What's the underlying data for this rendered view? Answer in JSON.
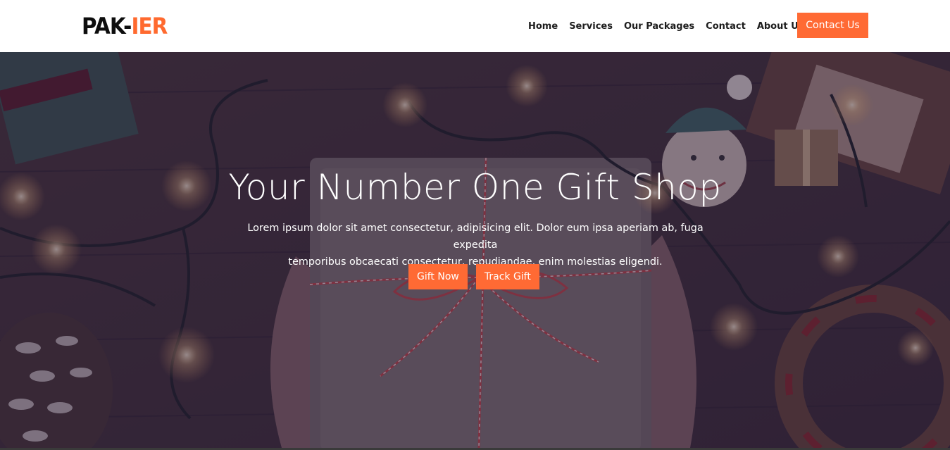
{
  "brand": {
    "logo_dark": "PAK-",
    "logo_accent": "IER",
    "accent_color": "#ff6a34"
  },
  "nav": {
    "items": [
      {
        "label": "Home"
      },
      {
        "label": "Services"
      },
      {
        "label": "Our Packages"
      },
      {
        "label": "Contact"
      },
      {
        "label": "About Us"
      }
    ],
    "cta_label": "Contact Us"
  },
  "hero": {
    "title": "Your Number One Gift Shop",
    "text_line1": "Lorem ipsum dolor sit amet consectetur, adipisicing elit. Dolor eum ipsa aperiam ab, fuga expedita",
    "text_line2": "temporibus obcaecati consectetur, repudiandae, enim molestias eligendi.",
    "primary_button": "Gift Now",
    "secondary_button": "Track Gift"
  }
}
